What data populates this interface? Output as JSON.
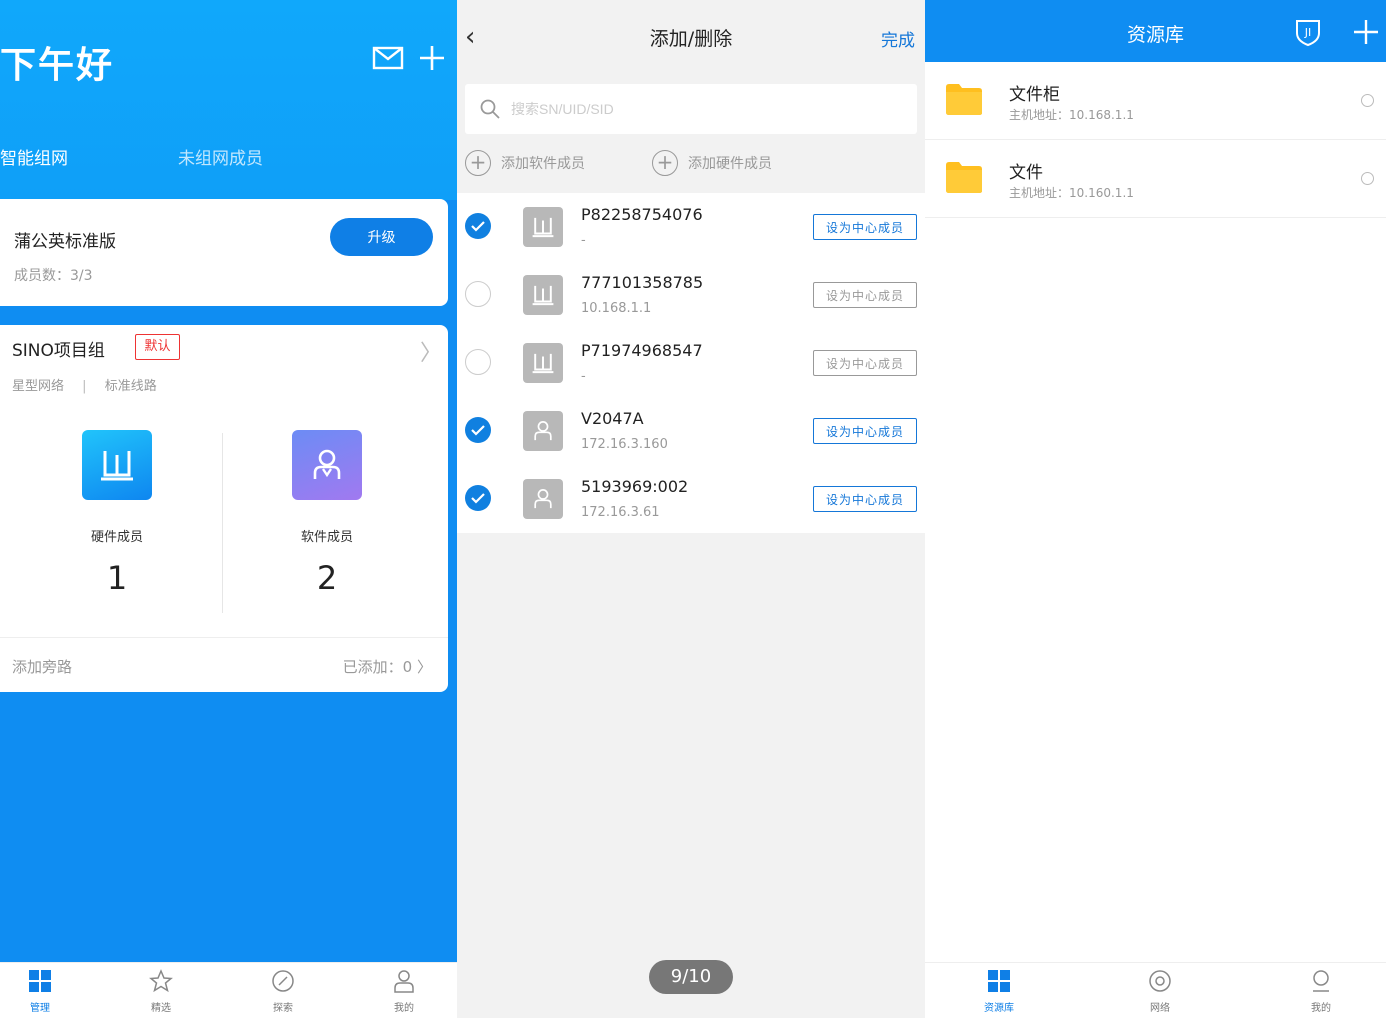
{
  "manage": {
    "greeting": "下午好",
    "tabs": [
      "智能组网",
      "未组网成员"
    ],
    "plan": {
      "title": "蒲公英标准版",
      "members_label": "成员数：",
      "members_value": "3/3",
      "upgrade_label": "升级"
    },
    "group": {
      "name": "SINO项目组",
      "badge": "默认",
      "network_type": "星型网络",
      "separator": "|",
      "line_type": "标准线路",
      "hardware_label": "硬件成员",
      "hardware_count": "1",
      "software_label": "软件成员",
      "software_count": "2",
      "bypass_label": "添加旁路",
      "bypass_added": "已添加：0"
    },
    "tabbar": [
      "管理",
      "精选",
      "探索",
      "我的"
    ]
  },
  "edit": {
    "title": "添加/删除",
    "done": "完成",
    "search_placeholder": "搜索SN/UID/SID",
    "add_software": "添加软件成员",
    "add_hardware": "添加硬件成员",
    "set_center_label": "设为中心成员",
    "devices": [
      {
        "name": "P82258754076",
        "sub": "-",
        "checked": true,
        "type": "router"
      },
      {
        "name": "777101358785",
        "sub": "10.168.1.1",
        "checked": false,
        "type": "router"
      },
      {
        "name": "P71974968547",
        "sub": "-",
        "checked": false,
        "type": "router"
      },
      {
        "name": "V2047A",
        "sub": "172.16.3.160",
        "checked": true,
        "type": "user"
      },
      {
        "name": "5193969:002",
        "sub": "172.16.3.61",
        "checked": true,
        "type": "user"
      }
    ],
    "pager": "9/10"
  },
  "library": {
    "title": "资源库",
    "items": [
      {
        "name": "文件柜",
        "address": "主机地址：10.168.1.1"
      },
      {
        "name": "文件",
        "address": "主机地址：10.160.1.1"
      }
    ],
    "tabbar": [
      "资源库",
      "网络",
      "我的"
    ]
  },
  "colors": {
    "primary": "#0f8df2",
    "accent": "#1577d8",
    "badge": "#e33333",
    "folder": "#ffbf1f"
  }
}
